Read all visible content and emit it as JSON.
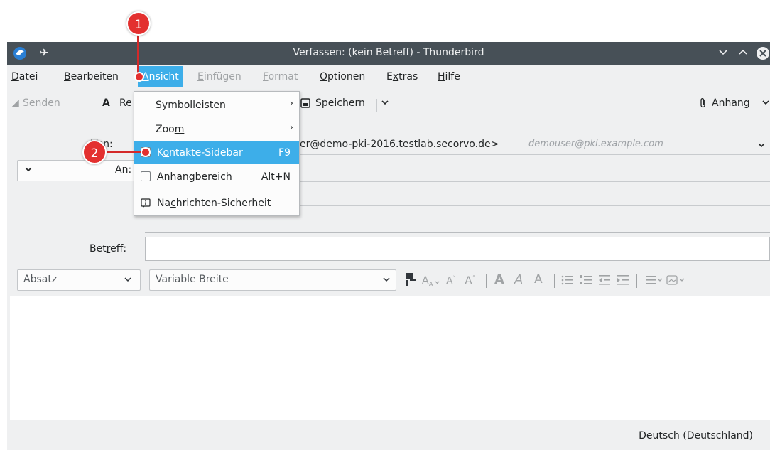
{
  "window": {
    "title": "Verfassen: (kein Betreff) - Thunderbird"
  },
  "menubar": {
    "items": [
      {
        "pre": "",
        "u": "D",
        "post": "atei"
      },
      {
        "pre": "",
        "u": "B",
        "post": "earbeiten"
      },
      {
        "pre": "",
        "u": "A",
        "post": "nsicht"
      },
      {
        "pre": "",
        "u": "E",
        "post": "infügen"
      },
      {
        "pre": "",
        "u": "F",
        "post": "ormat"
      },
      {
        "pre": "",
        "u": "O",
        "post": "ptionen"
      },
      {
        "pre": "E",
        "u": "x",
        "post": "tras"
      },
      {
        "pre": "",
        "u": "H",
        "post": "ilfe"
      }
    ]
  },
  "toolbar": {
    "send_label": "Senden",
    "spell_label": "Re",
    "save_label": "Speichern",
    "attach_label": "Anhang"
  },
  "header": {
    "from_label_pre": "",
    "from_label_u": "V",
    "from_label_post": "on:",
    "from_value": "er@demo-pki-2016.testlab.secorvo.de>",
    "from_alias": "demouser@pki.example.com",
    "to_label": "An:",
    "subject_label_pre": "Bet",
    "subject_label_u": "r",
    "subject_label_post": "eff:"
  },
  "format_bar": {
    "paragraph_value": "Absatz",
    "font_value": "Variable Breite"
  },
  "status": {
    "language": "Deutsch (Deutschland)"
  },
  "dropdown": {
    "items": [
      {
        "pre": "S",
        "u": "y",
        "post": "mbolleisten",
        "shortcut": ""
      },
      {
        "pre": "Zoo",
        "u": "m",
        "post": "",
        "shortcut": ""
      },
      {
        "pre": "K",
        "u": "o",
        "post": "ntakte-Sidebar",
        "shortcut": "F9"
      },
      {
        "pre": "A",
        "u": "n",
        "post": "hangbereich",
        "shortcut": "Alt+N"
      },
      {
        "pre": "Na",
        "u": "c",
        "post": "hrichten-Sicherheit",
        "shortcut": ""
      }
    ]
  },
  "annotations": {
    "badge1": "1",
    "badge2": "2"
  },
  "colors": {
    "highlight": "#3daee9",
    "titlebar": "#475057",
    "annotation": "#e3302f"
  }
}
